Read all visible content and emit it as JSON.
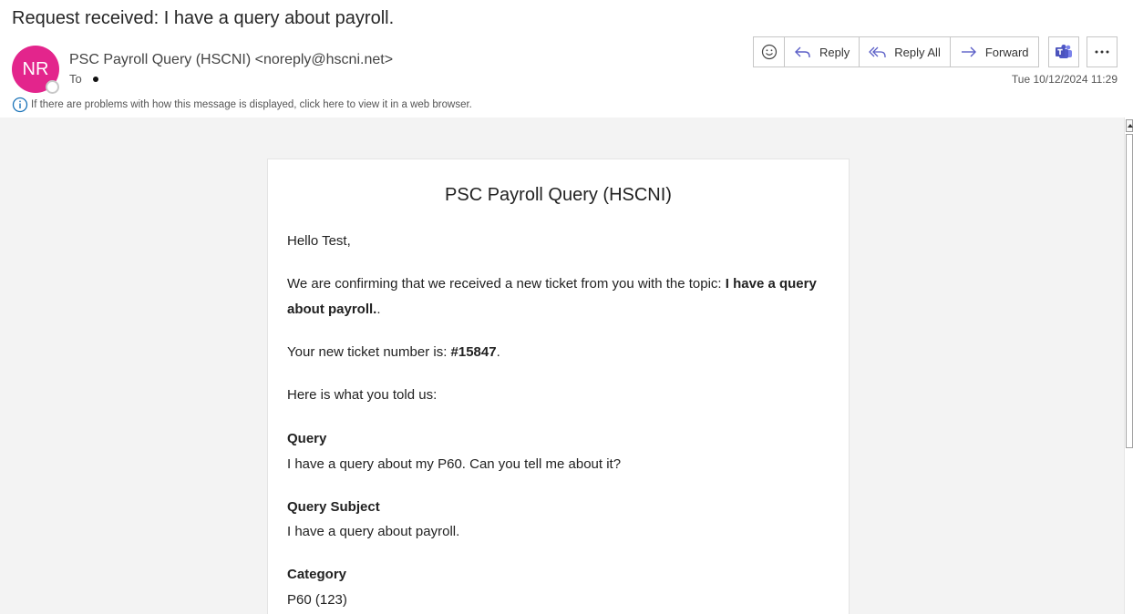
{
  "email": {
    "subject": "Request received: I have a query about payroll.",
    "sender_initials": "NR",
    "sender": "PSC Payroll Query (HSCNI) <noreply@hscni.net>",
    "to_label": "To",
    "info_text": "If there are problems with how this message is displayed, click here to view it in a web browser.",
    "date": "Tue 10/12/2024 11:29",
    "avatar_color": "#e3258c"
  },
  "actions": {
    "reply": "Reply",
    "reply_all": "Reply All",
    "forward": "Forward",
    "emoji_icon": "smiley-icon",
    "teams_icon": "teams-icon",
    "more_icon": "ellipsis-icon"
  },
  "message": {
    "title": "PSC Payroll Query (HSCNI)",
    "greeting": "Hello Test,",
    "confirm_prefix": "We are confirming that we received a new ticket from you with the topic: ",
    "topic": "I have a query about payroll.",
    "confirm_suffix": ".",
    "ticket_prefix": "Your new ticket number is: ",
    "ticket_number": "#15847",
    "ticket_suffix": ".",
    "told_us": "Here is what you told us:",
    "fields": [
      {
        "label": "Query",
        "value": "I have a query about my P60. Can you tell me about it?"
      },
      {
        "label": "Query Subject",
        "value": "I have a query about payroll."
      },
      {
        "label": "Category",
        "value": "P60 (123)"
      }
    ]
  }
}
